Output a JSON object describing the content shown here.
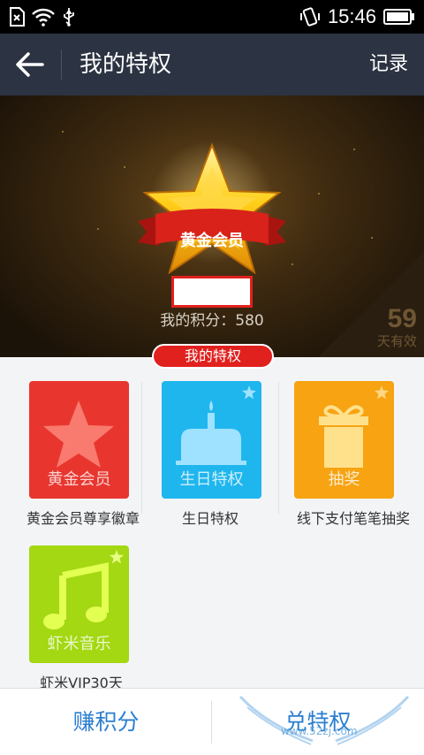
{
  "status_bar": {
    "time": "15:46"
  },
  "header": {
    "title": "我的特权",
    "records_label": "记录"
  },
  "hero": {
    "badge_text": "黄金会员",
    "points_text": "我的积分：580",
    "days_number": "59",
    "days_text": "天有效"
  },
  "section_tag": "我的特权",
  "privileges": [
    {
      "tile_label": "黄金会员",
      "caption": "黄金会员尊享徽章",
      "color": "#e8362f",
      "icon": "star-icon"
    },
    {
      "tile_label": "生日特权",
      "caption": "生日特权",
      "color": "#1fb6ee",
      "icon": "birthday-cake-icon"
    },
    {
      "tile_label": "抽奖",
      "caption": "线下支付笔笔抽奖",
      "color": "#f7a312",
      "icon": "gift-icon"
    },
    {
      "tile_label": "虾米音乐",
      "caption": "虾米VIP30天",
      "color": "#a3d812",
      "icon": "music-note-icon"
    }
  ],
  "bottom": {
    "earn_label": "赚积分",
    "redeem_label": "兑特权"
  },
  "watermark": {
    "text": "www.52zj.com"
  }
}
